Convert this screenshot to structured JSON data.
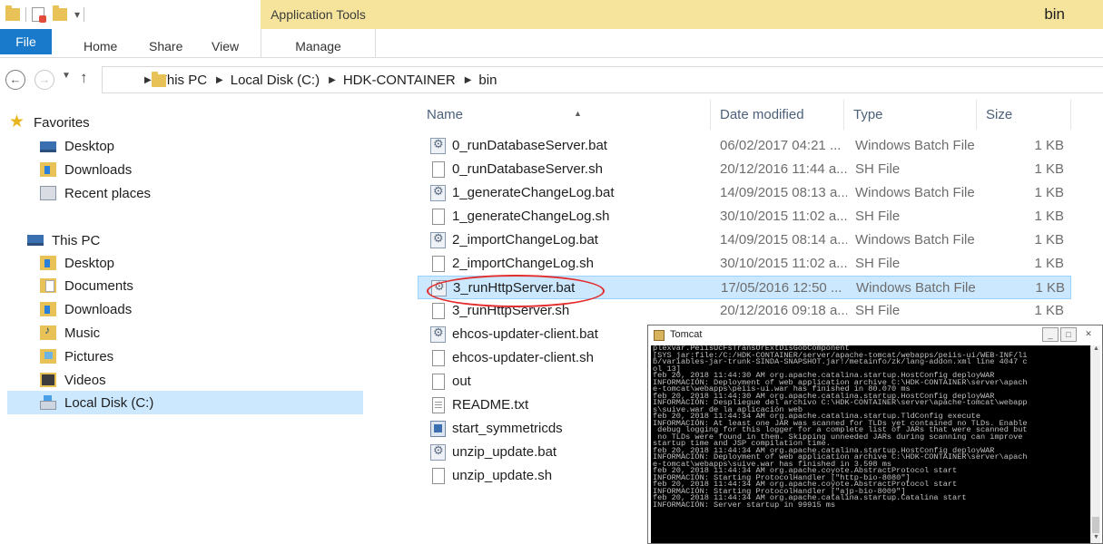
{
  "window": {
    "title": "bin",
    "context_tab": "Application Tools"
  },
  "ribbon": {
    "tabs": [
      "File",
      "Home",
      "Share",
      "View",
      "Manage"
    ]
  },
  "address": {
    "crumbs": [
      "This PC",
      "Local Disk (C:)",
      "HDK-CONTAINER",
      "bin"
    ]
  },
  "nav": {
    "favorites_label": "Favorites",
    "favorites": [
      "Desktop",
      "Downloads",
      "Recent places"
    ],
    "thispc_label": "This PC",
    "thispc": [
      "Desktop",
      "Documents",
      "Downloads",
      "Music",
      "Pictures",
      "Videos",
      "Local Disk (C:)"
    ]
  },
  "list": {
    "columns": [
      "Name",
      "Date modified",
      "Type",
      "Size"
    ],
    "rows": [
      {
        "name": "0_runDatabaseServer.bat",
        "date": "06/02/2017 04:21 ...",
        "type": "Windows Batch File",
        "size": "1 KB",
        "icon": "batch-file-icon"
      },
      {
        "name": "0_runDatabaseServer.sh",
        "date": "20/12/2016 11:44 a...",
        "type": "SH File",
        "size": "1 KB",
        "icon": "document-icon"
      },
      {
        "name": "1_generateChangeLog.bat",
        "date": "14/09/2015 08:13 a...",
        "type": "Windows Batch File",
        "size": "1 KB",
        "icon": "batch-file-icon"
      },
      {
        "name": "1_generateChangeLog.sh",
        "date": "30/10/2015 11:02 a...",
        "type": "SH File",
        "size": "1 KB",
        "icon": "document-icon"
      },
      {
        "name": "2_importChangeLog.bat",
        "date": "14/09/2015 08:14 a...",
        "type": "Windows Batch File",
        "size": "1 KB",
        "icon": "batch-file-icon"
      },
      {
        "name": "2_importChangeLog.sh",
        "date": "30/10/2015 11:02 a...",
        "type": "SH File",
        "size": "1 KB",
        "icon": "document-icon"
      },
      {
        "name": "3_runHttpServer.bat",
        "date": "17/05/2016 12:50 ...",
        "type": "Windows Batch File",
        "size": "1 KB",
        "icon": "batch-file-icon",
        "selected": true
      },
      {
        "name": "3_runHttpServer.sh",
        "date": "20/12/2016 09:18 a...",
        "type": "SH File",
        "size": "1 KB",
        "icon": "document-icon"
      },
      {
        "name": "ehcos-updater-client.bat",
        "date": "",
        "type": "",
        "size": "",
        "icon": "batch-file-icon"
      },
      {
        "name": "ehcos-updater-client.sh",
        "date": "",
        "type": "",
        "size": "",
        "icon": "document-icon"
      },
      {
        "name": "out",
        "date": "",
        "type": "",
        "size": "",
        "icon": "document-icon"
      },
      {
        "name": "README.txt",
        "date": "",
        "type": "",
        "size": "",
        "icon": "text-file-icon"
      },
      {
        "name": "start_symmetricds",
        "date": "",
        "type": "",
        "size": "",
        "icon": "shortcut-icon"
      },
      {
        "name": "unzip_update.bat",
        "date": "",
        "type": "",
        "size": "",
        "icon": "batch-file-icon"
      },
      {
        "name": "unzip_update.sh",
        "date": "",
        "type": "",
        "size": "",
        "icon": "document-icon"
      }
    ]
  },
  "console": {
    "title": "Tomcat",
    "lines": [
      "plexvar.PeiisUcFsTransOrExtDisGobComponent",
      "[SYS jar:file:/C:/HDK-CONTAINER/server/apache-tomcat/webapps/peiis-ui/WEB-INF/li",
      "b/variables-jar-trunk-SINDA-SNAPSHOT.jar!/metainfo/zk/lang-addon.xml line 4047 c",
      "ol 13]",
      "feb 20, 2018 11:44:30 AM org.apache.catalina.startup.HostConfig deployWAR",
      "INFORMACIÓN: Deployment of web application archive C:\\HDK-CONTAINER\\server\\apach",
      "e-tomcat\\webapps\\peiis-ui.war has finished in 80.070 ms",
      "feb 20, 2018 11:44:30 AM org.apache.catalina.startup.HostConfig deployWAR",
      "INFORMACIÓN: Despliegue del archivo C:\\HDK-CONTAINER\\server\\apache-tomcat\\webapp",
      "s\\suive.war de la aplicación web",
      "feb 20, 2018 11:44:34 AM org.apache.catalina.startup.TldConfig execute",
      "INFORMACIÓN: At least one JAR was scanned for TLDs yet contained no TLDs. Enable",
      " debug logging for this logger for a complete list of JARs that were scanned but",
      " no TLDs were found in them. Skipping unneeded JARs during scanning can improve",
      "startup time and JSP compilation time.",
      "feb 20, 2018 11:44:34 AM org.apache.catalina.startup.HostConfig deployWAR",
      "INFORMACIÓN: Deployment of web application archive C:\\HDK-CONTAINER\\server\\apach",
      "e-tomcat\\webapps\\suive.war has finished in 3.598 ms",
      "feb 20, 2018 11:44:34 AM org.apache.coyote.AbstractProtocol start",
      "INFORMACIÓN: Starting ProtocolHandler [\"http-bio-8080\"]",
      "feb 20, 2018 11:44:34 AM org.apache.coyote.AbstractProtocol start",
      "INFORMACIÓN: Starting ProtocolHandler [\"ajp-bio-8009\"]",
      "feb 20, 2018 11:44:34 AM org.apache.catalina.startup.Catalina start",
      "INFORMACIÓN: Server startup in 99915 ms"
    ]
  },
  "colors": {
    "accent": "#1979ca",
    "context_tab": "#f6e49c",
    "selection": "#cce8ff",
    "annotation_circle": "#e32c2c"
  }
}
